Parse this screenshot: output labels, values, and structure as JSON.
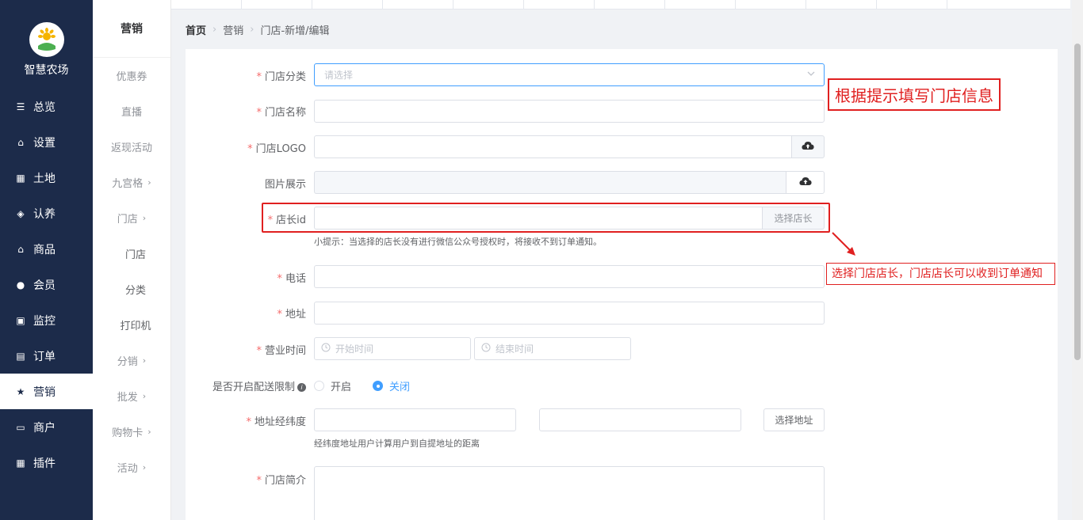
{
  "brand": {
    "name": "智慧农场"
  },
  "nav": [
    {
      "label": "总览",
      "icon": "sliders-icon"
    },
    {
      "label": "设置",
      "icon": "bag-icon"
    },
    {
      "label": "土地",
      "icon": "grid-icon"
    },
    {
      "label": "认养",
      "icon": "gem-icon"
    },
    {
      "label": "商品",
      "icon": "bag-icon"
    },
    {
      "label": "会员",
      "icon": "user-icon"
    },
    {
      "label": "监控",
      "icon": "camera-icon"
    },
    {
      "label": "订单",
      "icon": "clipboard-icon"
    },
    {
      "label": "营销",
      "icon": "star-icon",
      "active": true
    },
    {
      "label": "商户",
      "icon": "store-icon"
    },
    {
      "label": "插件",
      "icon": "grid-icon"
    }
  ],
  "subnav": {
    "title": "营销",
    "items": [
      {
        "label": "优惠券"
      },
      {
        "label": "直播"
      },
      {
        "label": "返现活动"
      },
      {
        "label": "九宫格",
        "chevron": "›"
      },
      {
        "label": "门店",
        "chevron": "›"
      },
      {
        "label": "门店",
        "child": true
      },
      {
        "label": "分类",
        "child": true
      },
      {
        "label": "打印机",
        "child": true
      },
      {
        "label": "分销",
        "chevron": "›"
      },
      {
        "label": "批发",
        "chevron": "›"
      },
      {
        "label": "购物卡",
        "chevron": "›"
      },
      {
        "label": "活动",
        "chevron": "›"
      }
    ]
  },
  "breadcrumb": {
    "home": "首页",
    "section": "营销",
    "page": "门店-新增/编辑"
  },
  "form": {
    "category_label": "门店分类",
    "category_placeholder": "请选择",
    "name_label": "门店名称",
    "logo_label": "门店LOGO",
    "gallery_label": "图片展示",
    "manager_label": "店长id",
    "manager_button": "选择店长",
    "manager_hint": "小提示：当选择的店长没有进行微信公众号授权时，将接收不到订单通知。",
    "phone_label": "电话",
    "address_label": "地址",
    "hours_label": "营业时间",
    "hours_start_placeholder": "开始时间",
    "hours_end_placeholder": "结束时间",
    "delivery_label": "是否开启配送限制",
    "delivery_on": "开启",
    "delivery_off": "关闭",
    "coords_label": "地址经纬度",
    "coords_button": "选择地址",
    "coords_hint": "经纬度地址用户计算用户到自提地址的距离",
    "intro_label": "门店简介"
  },
  "annotations": {
    "fill_hint": "根据提示填写门店信息",
    "manager_note": "选择门店店长，门店店长可以收到订单通知"
  },
  "colors": {
    "sidebar": "#1c2b4a",
    "primary": "#409eff",
    "required": "#f56c6c",
    "annotation": "#e02020"
  }
}
